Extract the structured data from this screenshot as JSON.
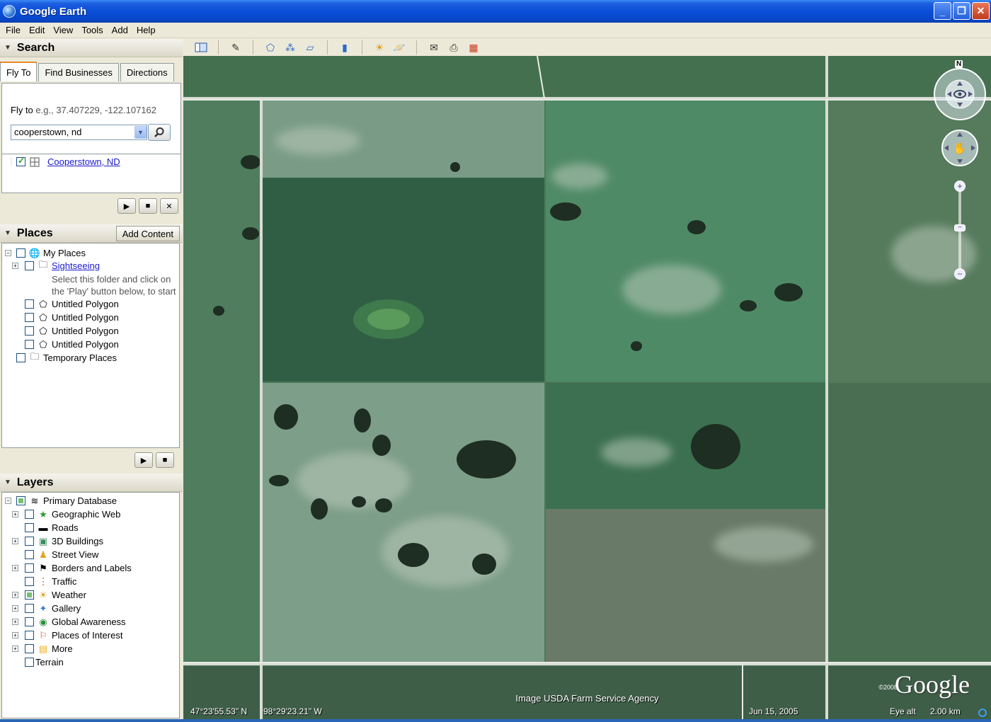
{
  "window": {
    "title": "Google Earth",
    "minimize": "_",
    "maximize": "❐",
    "close": "✕"
  },
  "menu": [
    "File",
    "Edit",
    "View",
    "Tools",
    "Add",
    "Help"
  ],
  "search": {
    "header": "Search",
    "tabs": [
      "Fly To",
      "Find Businesses",
      "Directions"
    ],
    "flyto_label": "Fly to",
    "flyto_hint": "e.g., 37.407229, -122.107162",
    "input_value": "cooperstown, nd",
    "result": "Cooperstown, ND"
  },
  "places": {
    "header": "Places",
    "add_content": "Add Content",
    "items": {
      "my_places": "My Places",
      "sightseeing": "Sightseeing",
      "sightseeing_desc": "Select this folder and click on the 'Play' button below, to start",
      "polygon1": "Untitled Polygon",
      "polygon2": "Untitled Polygon",
      "polygon3": "Untitled Polygon",
      "polygon4": "Untitled Polygon",
      "temporary": "Temporary Places"
    }
  },
  "layers": {
    "header": "Layers",
    "items": {
      "primary": "Primary Database",
      "geoweb": "Geographic Web",
      "roads": "Roads",
      "buildings": "3D Buildings",
      "streetview": "Street View",
      "borders": "Borders and Labels",
      "traffic": "Traffic",
      "weather": "Weather",
      "gallery": "Gallery",
      "global": "Global Awareness",
      "poi": "Places of Interest",
      "more": "More",
      "terrain": "Terrain"
    }
  },
  "map": {
    "attribution": "Image USDA Farm Service Agency",
    "logo": "Google",
    "copyright": "©2008",
    "latitude": "47°23'55.53\" N",
    "longitude": "98°29'23.21\" W",
    "date": "Jun 15, 2005",
    "eye_alt_label": "Eye alt",
    "eye_alt_value": "2.00 km",
    "compass_n": "N"
  }
}
